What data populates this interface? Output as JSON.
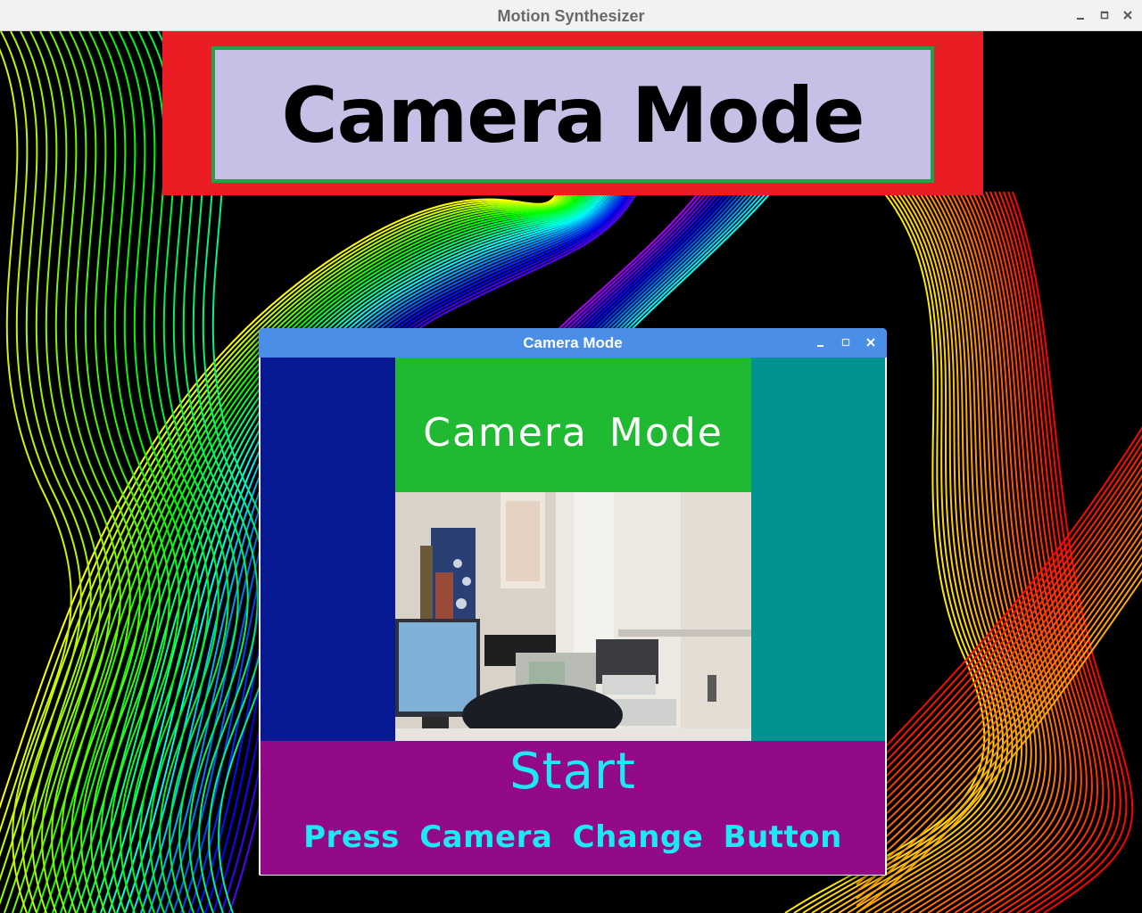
{
  "window": {
    "title": "Motion Synthesizer",
    "controls": [
      "minimize-icon",
      "maximize-icon",
      "close-icon"
    ]
  },
  "banner": {
    "title": "Camera Mode",
    "colors": {
      "outer": "#ec1c24",
      "inner": "#c8bfe7",
      "border": "#22a14a"
    }
  },
  "dialog": {
    "title": "Camera Mode",
    "controls": [
      "minimize-icon",
      "maximize-icon",
      "close-icon"
    ],
    "header_label": "Camera Mode",
    "start_label": "Start",
    "hint_label": "Press Camera Change Button",
    "colors": {
      "titlebar": "#4a8ee8",
      "left_panel": "#071a93",
      "right_panel": "#00938f",
      "header_panel": "#1fba32",
      "bottom_panel": "#930a89",
      "text_accent": "#1de9f2"
    }
  }
}
